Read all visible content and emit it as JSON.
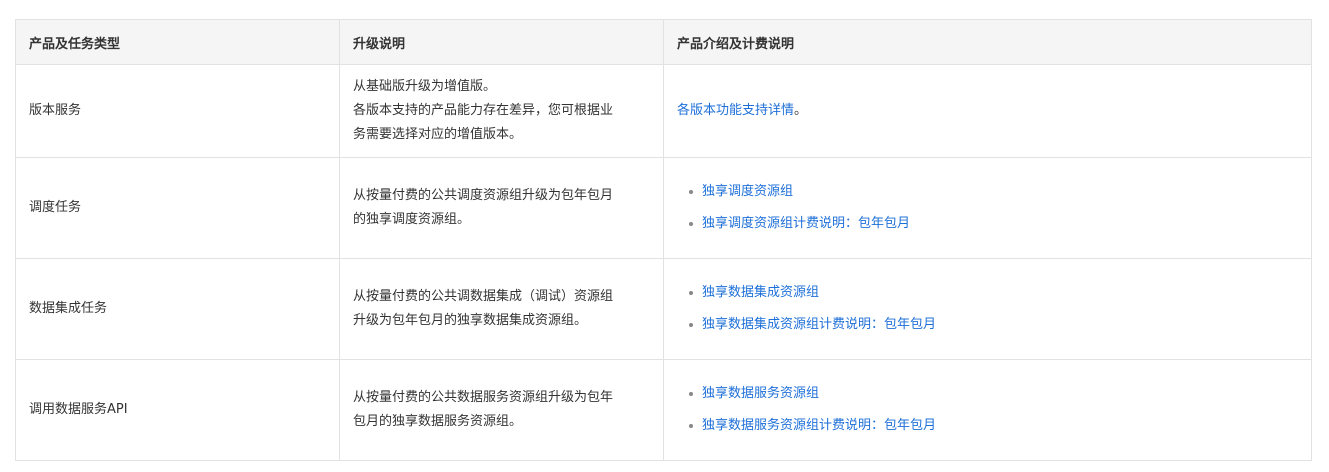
{
  "table": {
    "headers": [
      "产品及任务类型",
      "升级说明",
      "产品介绍及计费说明"
    ],
    "rows": [
      {
        "type": "版本服务",
        "desc": [
          "从基础版升级为增值版。",
          "各版本支持的产品能力存在差异，您可根据业",
          "务需要选择对应的增值版本。"
        ],
        "link_text": "各版本功能支持详情",
        "link_suffix": "。"
      },
      {
        "type": "调度任务",
        "desc": [
          "从按量付费的公共调度资源组升级为包年包月",
          "的独享调度资源组。"
        ],
        "links": [
          "独享调度资源组",
          "独享调度资源组计费说明：包年包月"
        ]
      },
      {
        "type": "数据集成任务",
        "desc": [
          "从按量付费的公共调数据集成（调试）资源组",
          "升级为包年包月的独享数据集成资源组。"
        ],
        "links": [
          "独享数据集成资源组",
          "独享数据集成资源组计费说明：包年包月"
        ]
      },
      {
        "type": "调用数据服务API",
        "desc": [
          "从按量付费的公共数据服务资源组升级为包年",
          "包月的独享数据服务资源组。"
        ],
        "links": [
          "独享数据服务资源组",
          "独享数据服务资源组计费说明：包年包月"
        ]
      }
    ]
  },
  "colors": {
    "link": "#1d6fd8",
    "header_bg": "#f5f5f5",
    "border": "#e2e2e2",
    "text": "#333333"
  }
}
